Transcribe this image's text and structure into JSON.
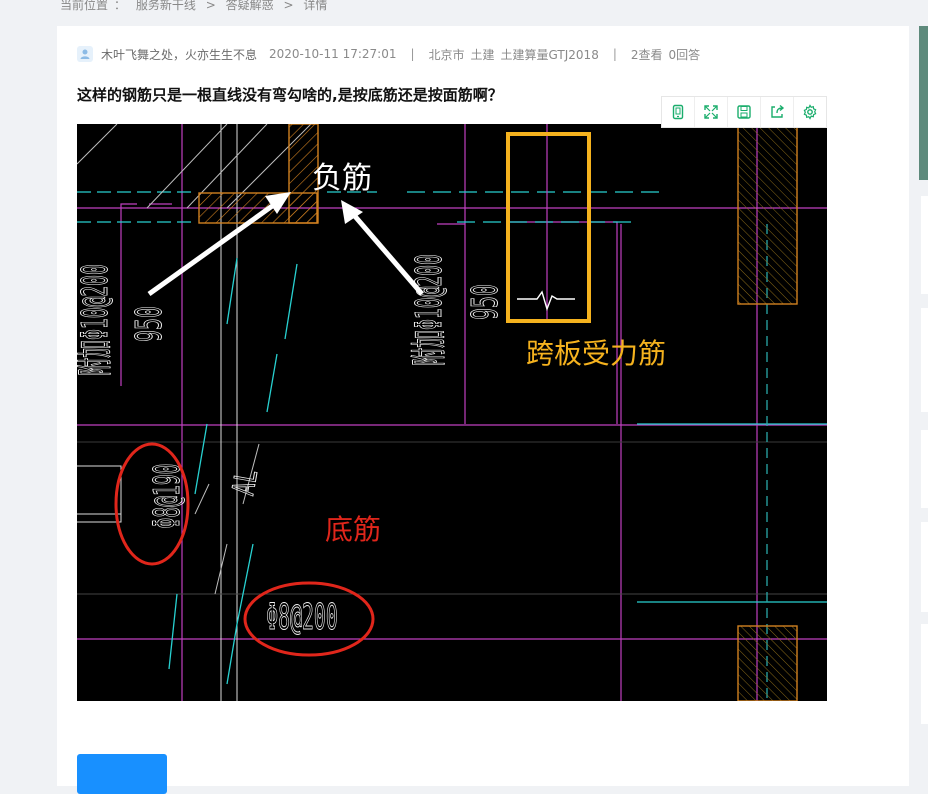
{
  "breadcrumb": {
    "label": "当前位置",
    "colon": "：",
    "items": [
      "服务新干线",
      "答疑解惑",
      "详情"
    ],
    "sep": ">"
  },
  "meta": {
    "author": "木叶飞舞之处，火亦生生不息",
    "datetime": "2020-10-11 17:27:01",
    "sep": "|",
    "city": "北京市",
    "major": "土建",
    "software": "土建算量GTJ2018",
    "views": "2查看",
    "answers": "0回答"
  },
  "question": {
    "title": "这样的钢筋只是一根直线没有弯勾啥的,是按底筋还是按面筋啊？"
  },
  "toolbar": {
    "icons": [
      "phone-icon",
      "fullscreen-icon",
      "save-icon",
      "share-icon",
      "settings-icon"
    ],
    "accent": "#1aad6c"
  },
  "drawing": {
    "labels": {
      "neg_rebar": "负筋",
      "span_rebar": "跨板受力筋",
      "bottom_rebar": "底筋",
      "dim_left": "950",
      "dim_right": "950",
      "rebar_top_left": "附加Φ10@200",
      "rebar_top_right": "附加Φ10@200",
      "rebar_left": "Φ8@190",
      "rebar_bottom": "Φ8@200",
      "al": "AL"
    },
    "colors": {
      "background": "#000000",
      "magenta": "#c040c0",
      "cyan": "#28d0d0",
      "hatch": "#d08020",
      "annotation_white": "#ffffff",
      "annotation_orange": "#f5b21e",
      "annotation_red": "#e0261b"
    }
  }
}
